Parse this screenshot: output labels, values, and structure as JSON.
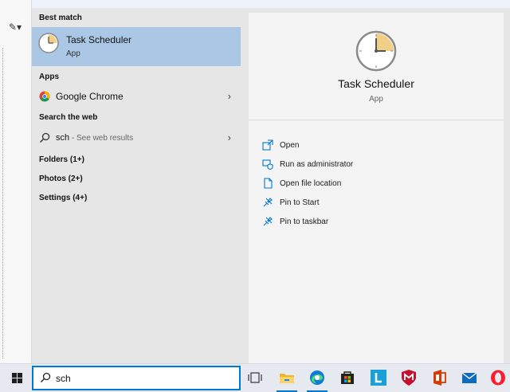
{
  "start_menu": {
    "best_match": {
      "header": "Best match",
      "title": "Task Scheduler",
      "subtitle": "App"
    },
    "apps": {
      "header": "Apps",
      "items": [
        {
          "label": "Google Chrome"
        }
      ]
    },
    "web": {
      "header": "Search the web",
      "query": "sch",
      "suffix": " - See web results"
    },
    "categories": [
      "Folders (1+)",
      "Photos (2+)",
      "Settings (4+)"
    ]
  },
  "details": {
    "title": "Task Scheduler",
    "subtitle": "App",
    "actions": [
      {
        "label": "Open",
        "icon": "open-icon"
      },
      {
        "label": "Run as administrator",
        "icon": "shield-icon"
      },
      {
        "label": "Open file location",
        "icon": "file-icon"
      },
      {
        "label": "Pin to Start",
        "icon": "pin-icon"
      },
      {
        "label": "Pin to taskbar",
        "icon": "pin-icon"
      }
    ]
  },
  "taskbar": {
    "search_value": "sch",
    "pinned": [
      "task-view-icon",
      "file-explorer-icon",
      "edge-icon",
      "store-icon",
      "l-app-icon",
      "mcafee-icon",
      "office-icon",
      "mail-icon",
      "opera-icon"
    ]
  },
  "colors": {
    "accent": "#0078d4",
    "selection": "#aac8e6"
  }
}
